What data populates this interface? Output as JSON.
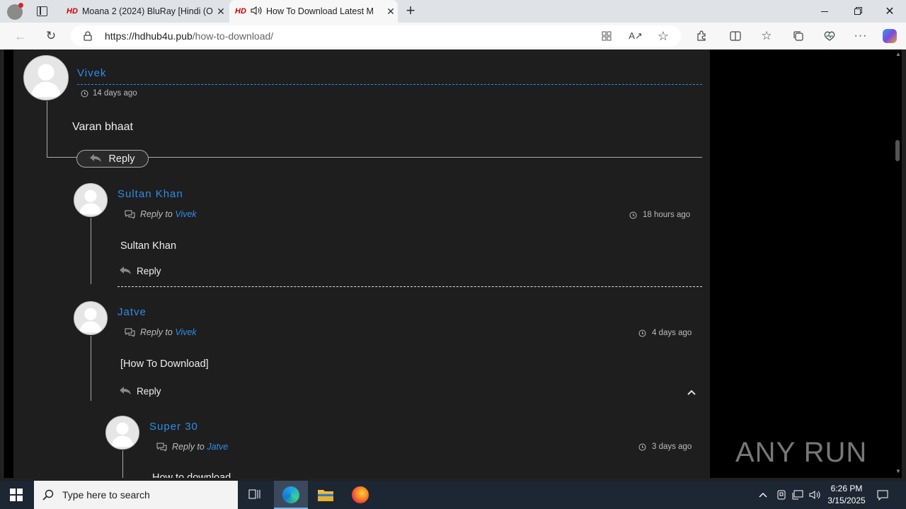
{
  "browser": {
    "tabs": [
      {
        "favicon": "HD",
        "title": "Moana 2 (2024) BluRay [Hindi (O",
        "close": "✕"
      },
      {
        "favicon": "HD",
        "title": "How To Download Latest M",
        "close": "✕"
      }
    ],
    "new_tab": "+",
    "url_host": "https://hdhub4u.pub",
    "url_path": "/how-to-download/"
  },
  "comments": [
    {
      "author": "Vivek",
      "time": "14 days ago",
      "text": "Varan bhaat",
      "reply": "Reply"
    },
    {
      "author": "Sultan Khan",
      "reply_to_label": "Reply to",
      "reply_to": "Vivek",
      "time": "18 hours ago",
      "text": "Sultan Khan",
      "reply": "Reply"
    },
    {
      "author": "Jatve",
      "reply_to_label": "Reply to",
      "reply_to": "Vivek",
      "time": "4 days ago",
      "text": "[How To Download]",
      "reply": "Reply"
    },
    {
      "author": "Super 30",
      "reply_to_label": "Reply to",
      "reply_to": "Jatve",
      "time": "3 days ago",
      "text": "How to download"
    }
  ],
  "watermark": "ANY RUN",
  "taskbar": {
    "search_placeholder": "Type here to search",
    "time": "6:26 PM",
    "date": "3/15/2025"
  },
  "icons": [
    "profile-icon",
    "tab-actions-icon",
    "speaker-icon",
    "back-icon",
    "refresh-icon",
    "lock-icon",
    "apps-icon",
    "read-aloud-icon",
    "favorite-icon",
    "extensions-icon",
    "split-icon",
    "favorites-icon",
    "collections-icon",
    "performance-icon",
    "more-icon",
    "copilot-icon",
    "clock-icon",
    "reply-arrow-icon",
    "comment-icon",
    "chevron-up-icon",
    "windows-icon",
    "search-icon",
    "task-view-icon",
    "edge-icon",
    "file-explorer-icon",
    "firefox-icon"
  ]
}
